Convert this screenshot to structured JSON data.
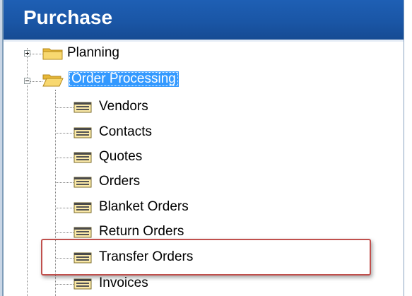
{
  "panel": {
    "title": "Purchase"
  },
  "tree": {
    "planning": {
      "label": "Planning",
      "expanded": false
    },
    "order_processing": {
      "label": "Order Processing",
      "expanded": true,
      "selected": true,
      "items": [
        {
          "label": "Vendors"
        },
        {
          "label": "Contacts"
        },
        {
          "label": "Quotes"
        },
        {
          "label": "Orders"
        },
        {
          "label": "Blanket Orders"
        },
        {
          "label": "Return Orders"
        },
        {
          "label": "Transfer Orders",
          "highlighted": true
        },
        {
          "label": "Invoices"
        }
      ]
    }
  },
  "colors": {
    "header_bg": "#1a56a6",
    "header_text": "#ffffff",
    "selection_bg": "#3399ff",
    "highlight_border": "#c0504d",
    "folder_yellow": "#f5d46a"
  },
  "icons": {
    "folder": "folder-icon",
    "folder_open": "folder-open-icon",
    "form": "form-icon",
    "expand": "plus-box-icon",
    "collapse": "minus-box-icon"
  }
}
